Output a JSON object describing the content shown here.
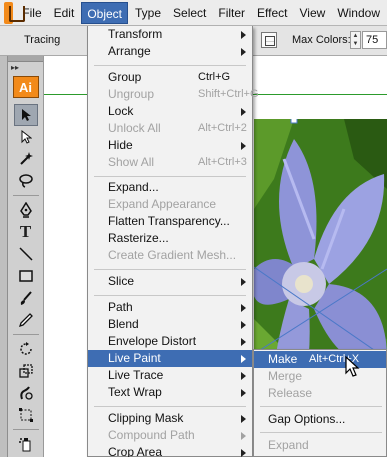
{
  "menubar": {
    "items": [
      "File",
      "Edit",
      "Object",
      "Type",
      "Select",
      "Filter",
      "Effect",
      "View",
      "Window"
    ],
    "active": "Object"
  },
  "controlbar": {
    "tracing_label": "Tracing",
    "max_colors_label": "Max Colors:",
    "max_colors_value": "75"
  },
  "toolbar": {
    "app_badge": "Ai",
    "text_tool_glyph": "T"
  },
  "object_menu": {
    "items": [
      {
        "label": "Transform",
        "submenu": true
      },
      {
        "label": "Arrange",
        "submenu": true
      },
      {
        "label": "Group",
        "shortcut": "Ctrl+G"
      },
      {
        "label": "Ungroup",
        "shortcut": "Shift+Ctrl+G",
        "disabled": true
      },
      {
        "label": "Lock",
        "submenu": true
      },
      {
        "label": "Unlock All",
        "shortcut": "Alt+Ctrl+2",
        "disabled": true
      },
      {
        "label": "Hide",
        "submenu": true
      },
      {
        "label": "Show All",
        "shortcut": "Alt+Ctrl+3",
        "disabled": true
      },
      {
        "label": "Expand..."
      },
      {
        "label": "Expand Appearance",
        "disabled": true
      },
      {
        "label": "Flatten Transparency..."
      },
      {
        "label": "Rasterize..."
      },
      {
        "label": "Create Gradient Mesh...",
        "disabled": true
      },
      {
        "label": "Slice",
        "submenu": true
      },
      {
        "label": "Path",
        "submenu": true
      },
      {
        "label": "Blend",
        "submenu": true
      },
      {
        "label": "Envelope Distort",
        "submenu": true
      },
      {
        "label": "Live Paint",
        "submenu": true,
        "highlighted": true
      },
      {
        "label": "Live Trace",
        "submenu": true
      },
      {
        "label": "Text Wrap",
        "submenu": true
      },
      {
        "label": "Clipping Mask",
        "submenu": true
      },
      {
        "label": "Compound Path",
        "submenu": true,
        "disabled": true
      },
      {
        "label": "Crop Area",
        "submenu": true
      }
    ]
  },
  "live_paint_submenu": {
    "items": [
      {
        "label": "Make",
        "shortcut": "Alt+Ctrl+X",
        "highlighted": true
      },
      {
        "label": "Merge",
        "disabled": true
      },
      {
        "label": "Release",
        "disabled": true
      },
      {
        "label": "Gap Options..."
      },
      {
        "label": "Expand",
        "disabled": true
      }
    ]
  },
  "colors": {
    "accent": "#3e6db3",
    "app_orange": "#f28a1a",
    "artboard_guide": "#2c9b2c"
  }
}
